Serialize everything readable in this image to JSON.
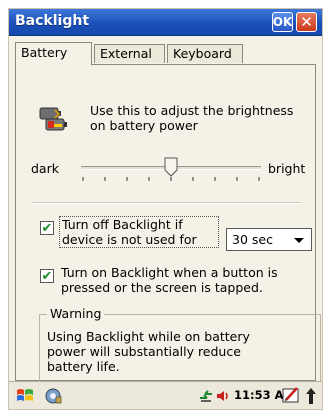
{
  "window": {
    "title": "Backlight",
    "ok_label": "OK",
    "close_label": "✕"
  },
  "tabs": [
    {
      "label": "Battery",
      "active": true
    },
    {
      "label": "External",
      "active": false
    },
    {
      "label": "Keyboard",
      "active": false
    }
  ],
  "battery": {
    "description": "Use this to adjust the brightness on battery power",
    "slider": {
      "min_label": "dark",
      "max_label": "bright",
      "level_fraction": 0.5,
      "tick_count": 9
    },
    "turn_off": {
      "checked": true,
      "label": "Turn off Backlight if device is not used for",
      "timeout_value": "30 sec"
    },
    "turn_on": {
      "checked": true,
      "label": "Turn on Backlight when a button is pressed or the screen is tapped."
    },
    "warning": {
      "title": "Warning",
      "text": "Using Backlight while on battery power will substantially reduce battery life."
    }
  },
  "taskbar": {
    "start_icon": "windows-flag-icon",
    "app_icon": "settings-app-icon",
    "network_icon": "network-connection-icon",
    "volume_icon": "speaker-icon",
    "time": "11:53 AM",
    "input_icon": "keyboard-pen-icon",
    "up_icon": "up-arrow-icon"
  },
  "colors": {
    "titlebar": "#1a50b8",
    "check": "#1c8c2a",
    "background": "#f4f1e6"
  }
}
